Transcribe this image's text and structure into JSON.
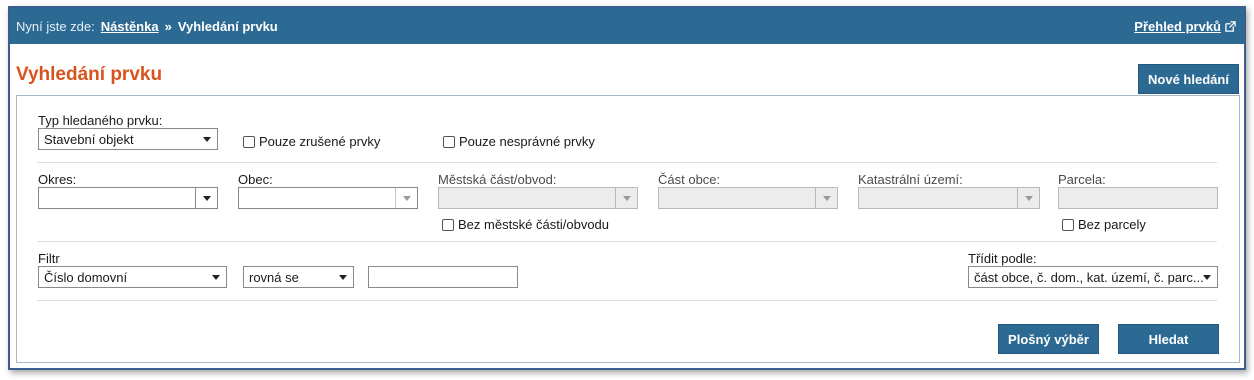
{
  "breadcrumb": {
    "prefix": "Nyní jste zde:",
    "home": "Nástěnka",
    "separator": "»",
    "current": "Vyhledání prvku"
  },
  "header_link": {
    "label": "Přehled prvků",
    "icon": "external-link-icon"
  },
  "page": {
    "title": "Vyhledání prvku",
    "new_search": "Nové hledání"
  },
  "element_type": {
    "label": "Typ hledaného prvku:",
    "value": "Stavební objekt",
    "only_cancelled": "Pouze zrušené prvky",
    "only_incorrect": "Pouze nesprávné prvky"
  },
  "location": {
    "district": {
      "label": "Okres:",
      "value": ""
    },
    "municipality": {
      "label": "Obec:",
      "value": ""
    },
    "city_part": {
      "label": "Městská část/obvod:",
      "value": ""
    },
    "without_city_part": "Bez městské části/obvodu",
    "municipality_part": {
      "label": "Část obce:",
      "value": ""
    },
    "cadastral_area": {
      "label": "Katastrální území:",
      "value": ""
    },
    "parcel": {
      "label": "Parcela:",
      "value": ""
    },
    "without_parcel": "Bez parcely"
  },
  "filter": {
    "label": "Filtr",
    "field": "Číslo domovní",
    "operator": "rovná se",
    "value": ""
  },
  "sort": {
    "label": "Třídit podle:",
    "value": "část obce, č. dom., kat. území, č. parc..."
  },
  "actions": {
    "area_select": "Plošný výběr",
    "search": "Hledat"
  }
}
